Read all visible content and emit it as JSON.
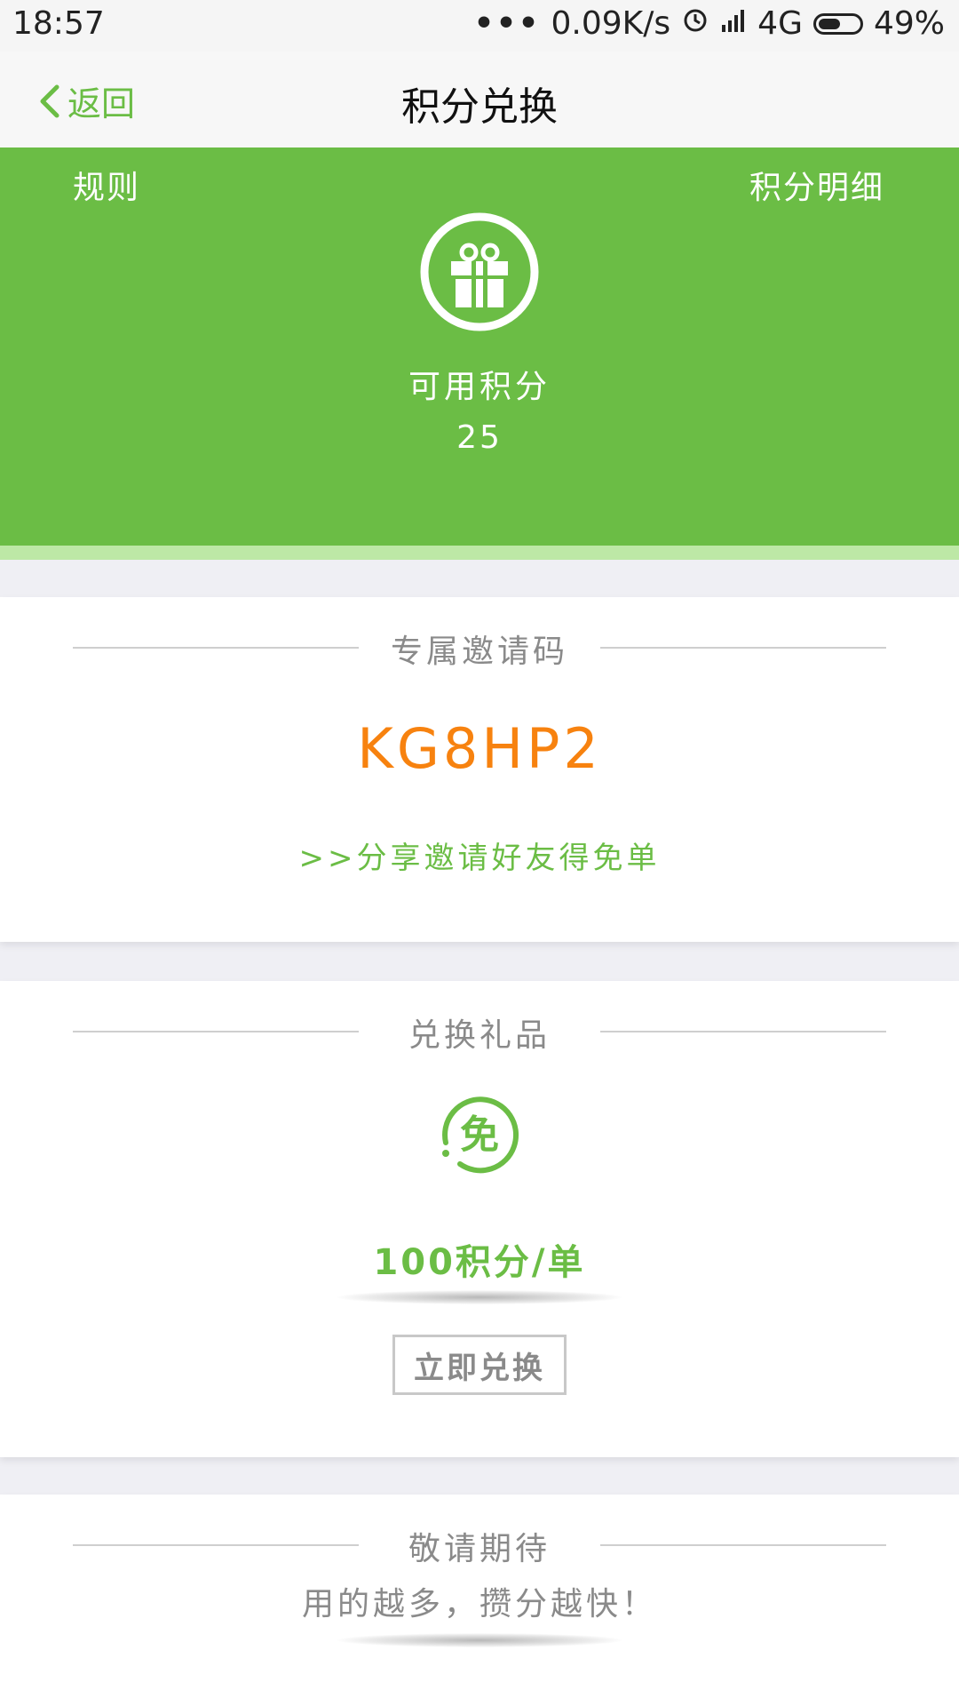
{
  "status_bar": {
    "time": "18:57",
    "network_speed": "0.09K/s",
    "network_type": "4G",
    "battery": "49%"
  },
  "nav": {
    "back_label": "返回",
    "title": "积分兑换"
  },
  "hero": {
    "rules_label": "规则",
    "detail_label": "积分明细",
    "available_label": "可用积分",
    "available_points": "25",
    "icon": "gift-icon"
  },
  "invite": {
    "section_title": "专属邀请码",
    "code": "KG8HP2",
    "share_text": ">>分享邀请好友得免单"
  },
  "exchange": {
    "section_title": "兑换礼品",
    "icon": "free-order-icon",
    "icon_char": "免",
    "price": "100积分/单",
    "button_label": "立即兑换"
  },
  "coming": {
    "section_title": "敬请期待",
    "slogan": "用的越多，攒分越快！"
  },
  "colors": {
    "brand_green": "#6bbd45",
    "code_orange": "#f7820f",
    "text_gray": "#8a8a8a"
  }
}
